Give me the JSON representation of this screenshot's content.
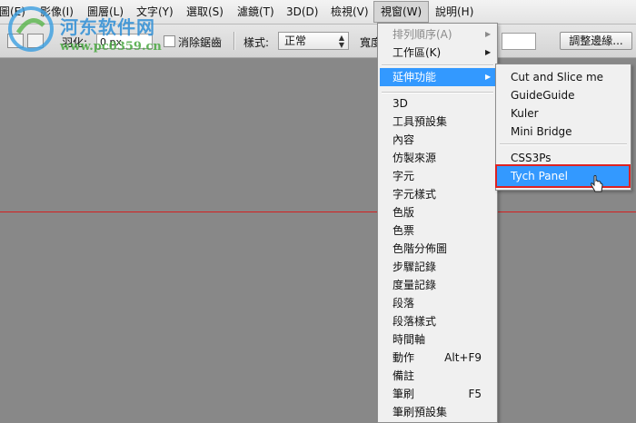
{
  "menubar": {
    "items": [
      {
        "label": "圖(E)"
      },
      {
        "label": "影像(I)"
      },
      {
        "label": "圖層(L)"
      },
      {
        "label": "文字(Y)"
      },
      {
        "label": "選取(S)"
      },
      {
        "label": "濾鏡(T)"
      },
      {
        "label": "3D(D)"
      },
      {
        "label": "檢視(V)"
      },
      {
        "label": "視窗(W)"
      },
      {
        "label": "說明(H)"
      }
    ],
    "active_item": "視窗(W)"
  },
  "options": {
    "feather_label": "羽化:",
    "feather_value": "0 px",
    "antialias_label": "消除鋸齒",
    "style_label": "樣式:",
    "style_value": "正常",
    "width_label": "寬度",
    "refine_edge_label": "調整邊緣..."
  },
  "watermark": {
    "title": "河东软件网",
    "url": "www.pc0359.cn"
  },
  "window_menu": {
    "items": [
      {
        "label": "排列順序(A)",
        "disabled": true,
        "has_submenu": true
      },
      {
        "label": "工作區(K)",
        "disabled": false,
        "has_submenu": true
      },
      {
        "label": "延伸功能",
        "disabled": false,
        "has_submenu": true,
        "highlighted": true
      },
      {
        "label": "3D"
      },
      {
        "label": "工具預設集"
      },
      {
        "label": "內容"
      },
      {
        "label": "仿製來源"
      },
      {
        "label": "字元"
      },
      {
        "label": "字元樣式"
      },
      {
        "label": "色版"
      },
      {
        "label": "色票"
      },
      {
        "label": "色階分佈圖"
      },
      {
        "label": "步驟記錄"
      },
      {
        "label": "度量記錄"
      },
      {
        "label": "段落"
      },
      {
        "label": "段落樣式"
      },
      {
        "label": "時間軸"
      },
      {
        "label": "動作",
        "shortcut": "Alt+F9"
      },
      {
        "label": "備註"
      },
      {
        "label": "筆刷",
        "shortcut": "F5"
      },
      {
        "label": "筆刷預設集"
      }
    ]
  },
  "extensions_submenu": {
    "items": [
      {
        "label": "Cut and Slice me"
      },
      {
        "label": "GuideGuide"
      },
      {
        "label": "Kuler"
      },
      {
        "label": "Mini Bridge"
      },
      {
        "label": "CSS3Ps"
      },
      {
        "label": "Tych Panel",
        "highlighted": true
      }
    ]
  },
  "colors": {
    "highlight": "#3399ff",
    "guide": "#d32020",
    "canvas": "#888888"
  }
}
